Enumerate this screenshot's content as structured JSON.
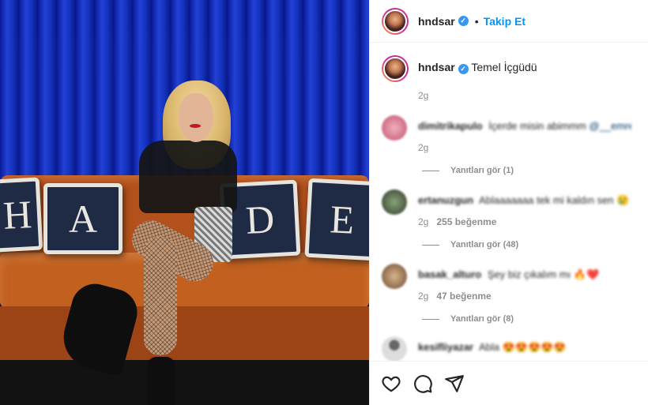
{
  "photo": {
    "pillow_letters": [
      "H",
      "A",
      "D",
      "E"
    ]
  },
  "post": {
    "username": "hndsar",
    "verified_mark": "✓",
    "separator": "•",
    "follow_label": "Takip Et",
    "caption_username": "hndsar",
    "caption_text": "Temel İçgüdü",
    "time": "2g"
  },
  "comments": [
    {
      "username": "dimitrikapulo",
      "text": "İçerde misin abimmm",
      "mention": "@__emre_b",
      "time": "2g",
      "likes": "",
      "replies_label": "Yanıtları gör (1)"
    },
    {
      "username": "ertanuzgun",
      "text": "Ablaaaaaaa tek mi kaldın sen 😢",
      "mention": "",
      "time": "2g",
      "likes": "255 beğenme",
      "replies_label": "Yanıtları gör (48)"
    },
    {
      "username": "basak_alturo",
      "text": "Şey biz çıkalım mı 🔥❤️",
      "mention": "",
      "time": "2g",
      "likes": "47 beğenme",
      "replies_label": "Yanıtları gör (8)"
    },
    {
      "username": "kesifliyazar",
      "text": "Abla 😍😍😍😍😍",
      "mention": "",
      "time": "",
      "likes": "",
      "replies_label": ""
    }
  ],
  "icons": {
    "like": "heart-icon",
    "comment": "comment-icon",
    "share": "share-icon"
  },
  "colors": {
    "accent": "#0095f6",
    "verified": "#3897f0",
    "muted": "#8e8e8e"
  }
}
